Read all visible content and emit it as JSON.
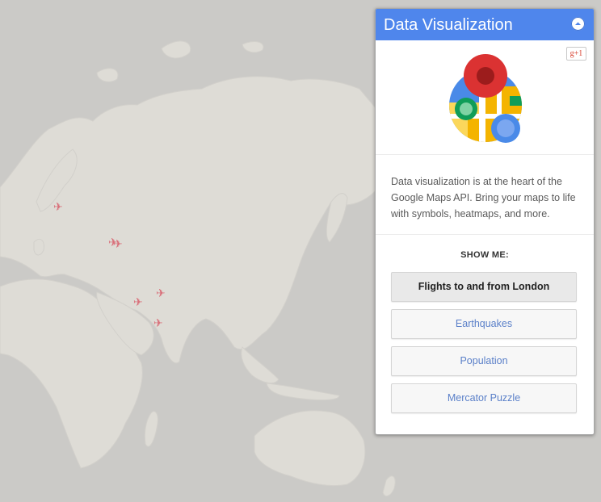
{
  "panel": {
    "title": "Data Visualization",
    "collapse_icon": "chevron-up-icon",
    "gplus_label": "g+1",
    "logo_icon": "data-visualization-logo-icon",
    "description": "Data visualization is at the heart of the Google Maps API. Bring your maps to life with symbols, heatmaps, and more.",
    "show_me_label": "SHOW ME:",
    "buttons": [
      {
        "label": "Flights to and from London",
        "active": true
      },
      {
        "label": "Earthquakes",
        "active": false
      },
      {
        "label": "Population",
        "active": false
      },
      {
        "label": "Mercator Puzzle",
        "active": false
      }
    ]
  },
  "map": {
    "land_color": "#dedcd6",
    "water_color": "#cbcac7",
    "marker_icon": "airplane-icon",
    "marker_color": "#d9707a"
  }
}
